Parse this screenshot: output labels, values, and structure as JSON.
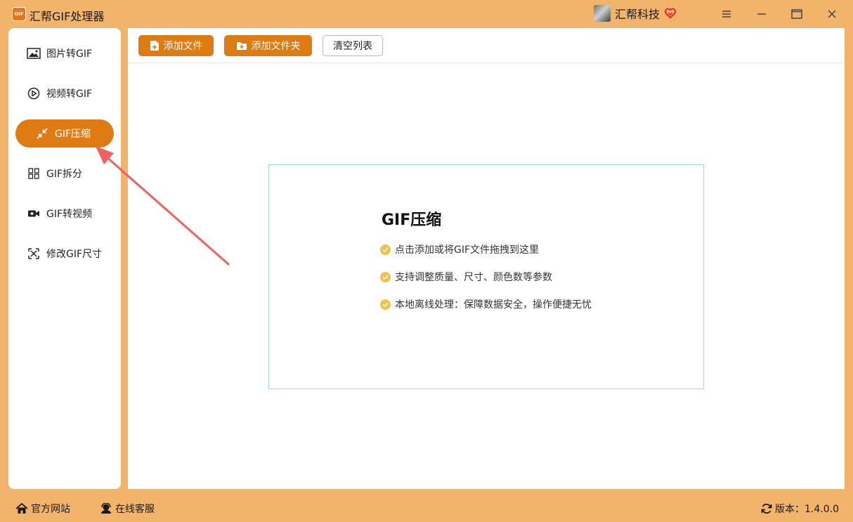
{
  "app": {
    "logo_text": "GIF",
    "title": "汇帮GIF处理器",
    "brand_name": "汇帮科技"
  },
  "window_controls": {
    "menu_icon": "hamburger-icon",
    "minimize_icon": "minimize-icon",
    "maximize_icon": "maximize-icon",
    "close_icon": "close-icon"
  },
  "sidebar": {
    "items": [
      {
        "label": "图片转GIF",
        "icon": "image-icon",
        "active": false
      },
      {
        "label": "视频转GIF",
        "icon": "play-icon",
        "active": false
      },
      {
        "label": "GIF压缩",
        "icon": "compress-icon",
        "active": true
      },
      {
        "label": "GIF拆分",
        "icon": "split-icon",
        "active": false
      },
      {
        "label": "GIF转视频",
        "icon": "video-camera-icon",
        "active": false
      },
      {
        "label": "修改GIF尺寸",
        "icon": "resize-icon",
        "active": false
      }
    ]
  },
  "toolbar": {
    "add_file_label": "添加文件",
    "add_folder_label": "添加文件夹",
    "clear_list_label": "清空列表"
  },
  "drop_zone": {
    "title": "GIF压缩",
    "lines": [
      "点击添加或将GIF文件拖拽到这里",
      "支持调整质量、尺寸、颜色数等参数",
      "本地离线处理：保障数据安全，操作便捷无忧"
    ]
  },
  "footer": {
    "website_label": "官方网站",
    "support_label": "在线客服",
    "version_label": "版本：1.4.0.0"
  },
  "colors": {
    "background": "#f2b36a",
    "accent": "#de7b12",
    "drop_border": "#9fdbd4",
    "check": "#f3c04e",
    "arrow": "#f0605f"
  }
}
